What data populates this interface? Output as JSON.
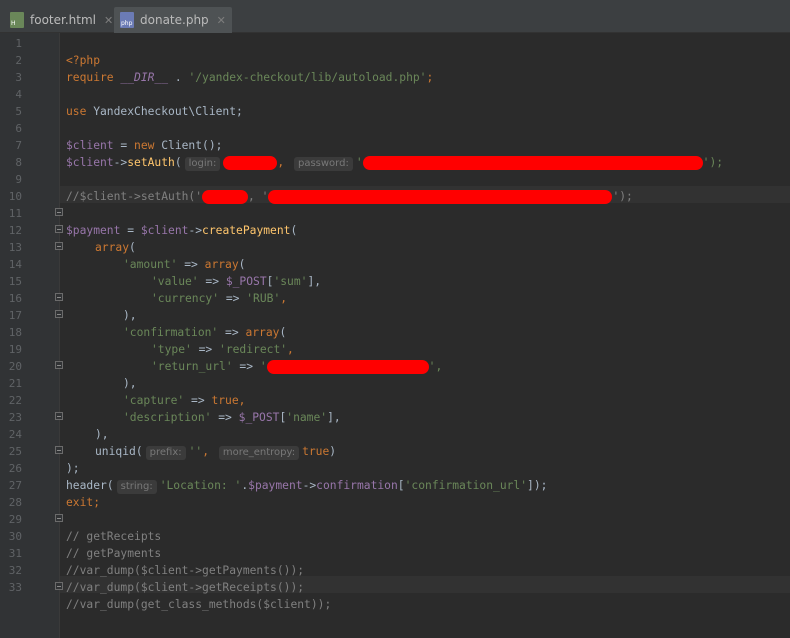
{
  "tabs": [
    {
      "label": "footer.html",
      "icon": "html-file-icon",
      "active": false
    },
    {
      "label": "donate.php",
      "icon": "php-file-icon",
      "active": true
    }
  ],
  "line_numbers": [
    "1",
    "2",
    "3",
    "4",
    "5",
    "6",
    "7",
    "8",
    "9",
    "10",
    "11",
    "12",
    "13",
    "14",
    "15",
    "16",
    "17",
    "18",
    "19",
    "20",
    "21",
    "22",
    "23",
    "24",
    "25",
    "26",
    "27",
    "28",
    "29",
    "30",
    "31",
    "32",
    "33"
  ],
  "code": {
    "l1": "<?php",
    "l2_kw": "require",
    "l2_const": " __DIR__ ",
    "l2_dot": ". ",
    "l2_str": "'/yandex-checkout/lib/autoload.php'",
    "l2_end": ";",
    "l4_kw": "use",
    "l4_rest": " YandexCheckout\\Client;",
    "l6_var": "$client",
    "l6_eq": " = ",
    "l6_new": "new",
    "l6_rest": " Client();",
    "l7_var": "$client",
    "l7_arrow": "->",
    "l7_fn": "setAuth",
    "l7_open": "(",
    "l7_hint_login": "login:",
    "l7_q1": " ",
    "l7_comma": ", ",
    "l7_hint_password": "password:",
    "l7_q2": "'",
    "l7_end": "');",
    "l9_comment_a": "//$client->setAuth('",
    "l9_comment_b": ", '",
    "l9_comment_c": "');",
    "l11_var": "$payment",
    "l11_eq": " = ",
    "l11_var2": "$client",
    "l11_arrow": "->",
    "l11_fn": "createPayment",
    "l11_end": "(",
    "l12_kw": "array",
    "l12_end": "(",
    "l13_str": "'amount'",
    "l13_op": " => ",
    "l13_kw": "array",
    "l13_end": "(",
    "l14_str": "'value'",
    "l14_op": " => ",
    "l14_var": "$_POST",
    "l14_idx_open": "[",
    "l14_idx": "'sum'",
    "l14_end": "],",
    "l15_str": "'currency'",
    "l15_op": " => ",
    "l15_val": "'RUB'",
    "l15_end": ",",
    "l16": "),",
    "l17_str": "'confirmation'",
    "l17_op": " => ",
    "l17_kw": "array",
    "l17_end": "(",
    "l18_str": "'type'",
    "l18_op": " => ",
    "l18_val": "'redirect'",
    "l18_end": ",",
    "l19_str": "'return_url'",
    "l19_op": " => ",
    "l19_q": "'",
    "l19_end": "',",
    "l20": "),",
    "l21_str": "'capture'",
    "l21_op": " => ",
    "l21_kw": "true",
    "l21_end": ",",
    "l22_str": "'description'",
    "l22_op": " => ",
    "l22_var": "$_POST",
    "l22_idx_open": "[",
    "l22_idx": "'name'",
    "l22_end": "],",
    "l23": "),",
    "l24_fn": "uniqid",
    "l24_open": "(",
    "l24_hint_prefix": "prefix:",
    "l24_str": "''",
    "l24_comma": ", ",
    "l24_hint_entropy": "more_entropy:",
    "l24_kw": "true",
    "l24_end": ")",
    "l25": ");",
    "l26_fn": "header",
    "l26_open": "(",
    "l26_hint": "string:",
    "l26_str": "'Location: '",
    "l26_dot": ".",
    "l26_var": "$payment",
    "l26_arrow": "->",
    "l26_prop": "confirmation",
    "l26_idx_open": "[",
    "l26_idx": "'confirmation_url'",
    "l26_end": "]);",
    "l27_kw": "exit",
    "l27_end": ";",
    "l29": "// getReceipts",
    "l30": "// getPayments",
    "l31": "//var_dump($client->getPayments());",
    "l32": "//var_dump($client->getReceipts());",
    "l33": "//var_dump(get_class_methods($client));"
  },
  "colors": {
    "background": "#2b2b2b",
    "keyword": "#cc7832",
    "variable": "#9876aa",
    "string": "#6a8759",
    "function": "#ffc66d",
    "comment": "#808080",
    "redaction": "#ff0000"
  }
}
